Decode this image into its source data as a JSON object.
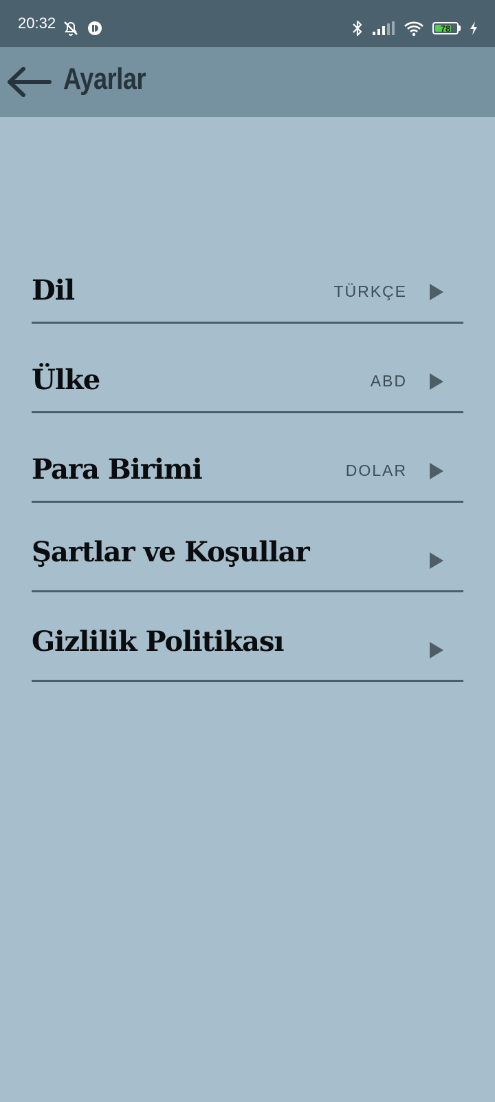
{
  "status_bar": {
    "time": "20:32",
    "left_icons": [
      "alarm-off-icon",
      "app-notification-icon"
    ],
    "right_icons": [
      "bluetooth-icon",
      "signal-icon",
      "wifi-icon",
      "battery-icon",
      "charging-icon"
    ],
    "battery_percent": "78",
    "battery_level": 0.78
  },
  "app_bar": {
    "back_icon": "arrow-left-icon",
    "title": "Ayarlar"
  },
  "settings": {
    "items": [
      {
        "label": "Dil",
        "value": "TÜRKÇE"
      },
      {
        "label": "Ülke",
        "value": "ABD"
      },
      {
        "label": "Para Birimi",
        "value": "DOLAR"
      },
      {
        "label": "Şartlar ve Koşullar",
        "value": ""
      },
      {
        "label": "Gizlilik Politikası",
        "value": ""
      }
    ],
    "chevron_icon": "play-arrow-right-icon"
  },
  "colors": {
    "status_bar": "#4b616e",
    "app_bar": "#7691a0",
    "background": "#a7bfcd",
    "divider": "#4b5f6b",
    "battery_fill": "#53d14c"
  }
}
